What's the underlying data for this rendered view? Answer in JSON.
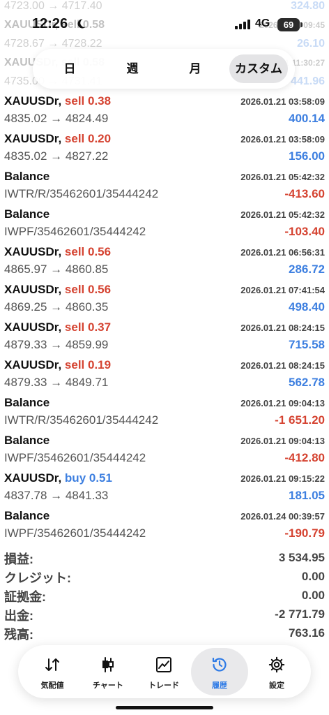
{
  "status_bar": {
    "time": "12:26",
    "network": "4G",
    "battery": "69"
  },
  "ghost_rows": [
    {
      "left": "4723.00 → 4717.40",
      "right": "324.80",
      "kind": "value"
    },
    {
      "left": "XAUUSDr, sell 0.58",
      "right": "2026.01.21 09:45",
      "kind": "sym"
    },
    {
      "left": "4728.67 → 4728.22",
      "right": "26.10",
      "kind": "value"
    },
    {
      "left": "XAUUSDr, sell 0.58",
      "right": "2026.01.21 11:30:27",
      "kind": "sym"
    },
    {
      "left": "4735.00 → 4731.41",
      "right": "441.96",
      "kind": "value"
    }
  ],
  "period_filter": {
    "tabs": [
      "日",
      "週",
      "月",
      "カスタム"
    ],
    "selected": "カスタム"
  },
  "history": [
    {
      "symbol": "XAUUSDr,",
      "side": "sell",
      "lot": "sell 0.38",
      "time": "2026.01.21 03:58:09",
      "prices": "4835.02 → 4824.49",
      "profit": "400.14",
      "sign": "pos"
    },
    {
      "symbol": "XAUUSDr,",
      "side": "sell",
      "lot": "sell 0.20",
      "time": "2026.01.21 03:58:09",
      "prices": "4835.02 → 4827.22",
      "profit": "156.00",
      "sign": "pos"
    },
    {
      "symbol": "Balance",
      "side": "",
      "lot": "",
      "time": "2026.01.21 05:42:32",
      "prices": "IWTR/R/35462601/35444242",
      "profit": "-413.60",
      "sign": "neg"
    },
    {
      "symbol": "Balance",
      "side": "",
      "lot": "",
      "time": "2026.01.21 05:42:32",
      "prices": "IWPF/35462601/35444242",
      "profit": "-103.40",
      "sign": "neg"
    },
    {
      "symbol": "XAUUSDr,",
      "side": "sell",
      "lot": "sell 0.56",
      "time": "2026.01.21 06:56:31",
      "prices": "4865.97 → 4860.85",
      "profit": "286.72",
      "sign": "pos"
    },
    {
      "symbol": "XAUUSDr,",
      "side": "sell",
      "lot": "sell 0.56",
      "time": "2026.01.21 07:41:54",
      "prices": "4869.25 → 4860.35",
      "profit": "498.40",
      "sign": "pos"
    },
    {
      "symbol": "XAUUSDr,",
      "side": "sell",
      "lot": "sell 0.37",
      "time": "2026.01.21 08:24:15",
      "prices": "4879.33 → 4859.99",
      "profit": "715.58",
      "sign": "pos"
    },
    {
      "symbol": "XAUUSDr,",
      "side": "sell",
      "lot": "sell 0.19",
      "time": "2026.01.21 08:24:15",
      "prices": "4879.33 → 4849.71",
      "profit": "562.78",
      "sign": "pos"
    },
    {
      "symbol": "Balance",
      "side": "",
      "lot": "",
      "time": "2026.01.21 09:04:13",
      "prices": "IWTR/R/35462601/35444242",
      "profit": "-1 651.20",
      "sign": "neg"
    },
    {
      "symbol": "Balance",
      "side": "",
      "lot": "",
      "time": "2026.01.21 09:04:13",
      "prices": "IWPF/35462601/35444242",
      "profit": "-412.80",
      "sign": "neg"
    },
    {
      "symbol": "XAUUSDr,",
      "side": "buy",
      "lot": "buy 0.51",
      "time": "2026.01.21 09:15:22",
      "prices": "4837.78 → 4841.33",
      "profit": "181.05",
      "sign": "pos"
    },
    {
      "symbol": "Balance",
      "side": "",
      "lot": "",
      "time": "2026.01.24 00:39:57",
      "prices": "IWPF/35462601/35444242",
      "profit": "-190.79",
      "sign": "neg"
    }
  ],
  "summary": [
    {
      "label": "損益:",
      "value": "3 534.95"
    },
    {
      "label": "クレジット:",
      "value": "0.00"
    },
    {
      "label": "証拠金:",
      "value": "0.00"
    },
    {
      "label": "出金:",
      "value": "-2 771.79"
    },
    {
      "label": "残高:",
      "value": "763.16"
    }
  ],
  "tabbar": {
    "items": [
      {
        "label": "気配値",
        "icon": "sort-arrows-icon"
      },
      {
        "label": "チャート",
        "icon": "candlestick-icon"
      },
      {
        "label": "トレード",
        "icon": "trend-chart-icon"
      },
      {
        "label": "履歴",
        "icon": "history-clock-icon"
      },
      {
        "label": "設定",
        "icon": "gear-icon"
      }
    ],
    "active": "履歴"
  },
  "colors": {
    "sell": "#d54331",
    "buy": "#3d7fe0",
    "positive": "#3d7fe0",
    "negative": "#d54331",
    "active_tab": "#2f7be6"
  }
}
